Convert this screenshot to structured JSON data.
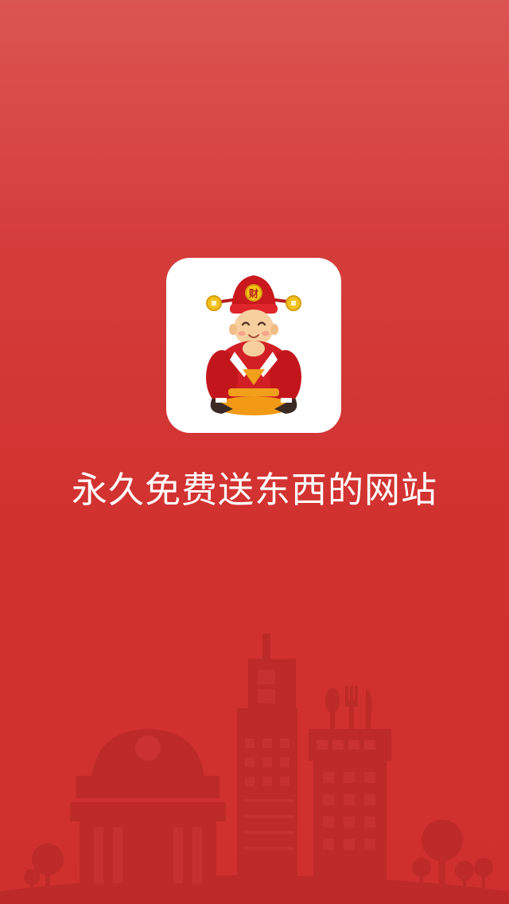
{
  "splash": {
    "app_icon": {
      "icon": "caishen-mascot-icon",
      "badge_text": "财",
      "background": "#ffffff"
    },
    "slogan": "永久免费送东西的网站",
    "background_colors": [
      "#db5552",
      "#cf302e"
    ],
    "skyline": {
      "icon": "city-skyline-illustration",
      "color": "#b92926"
    }
  }
}
